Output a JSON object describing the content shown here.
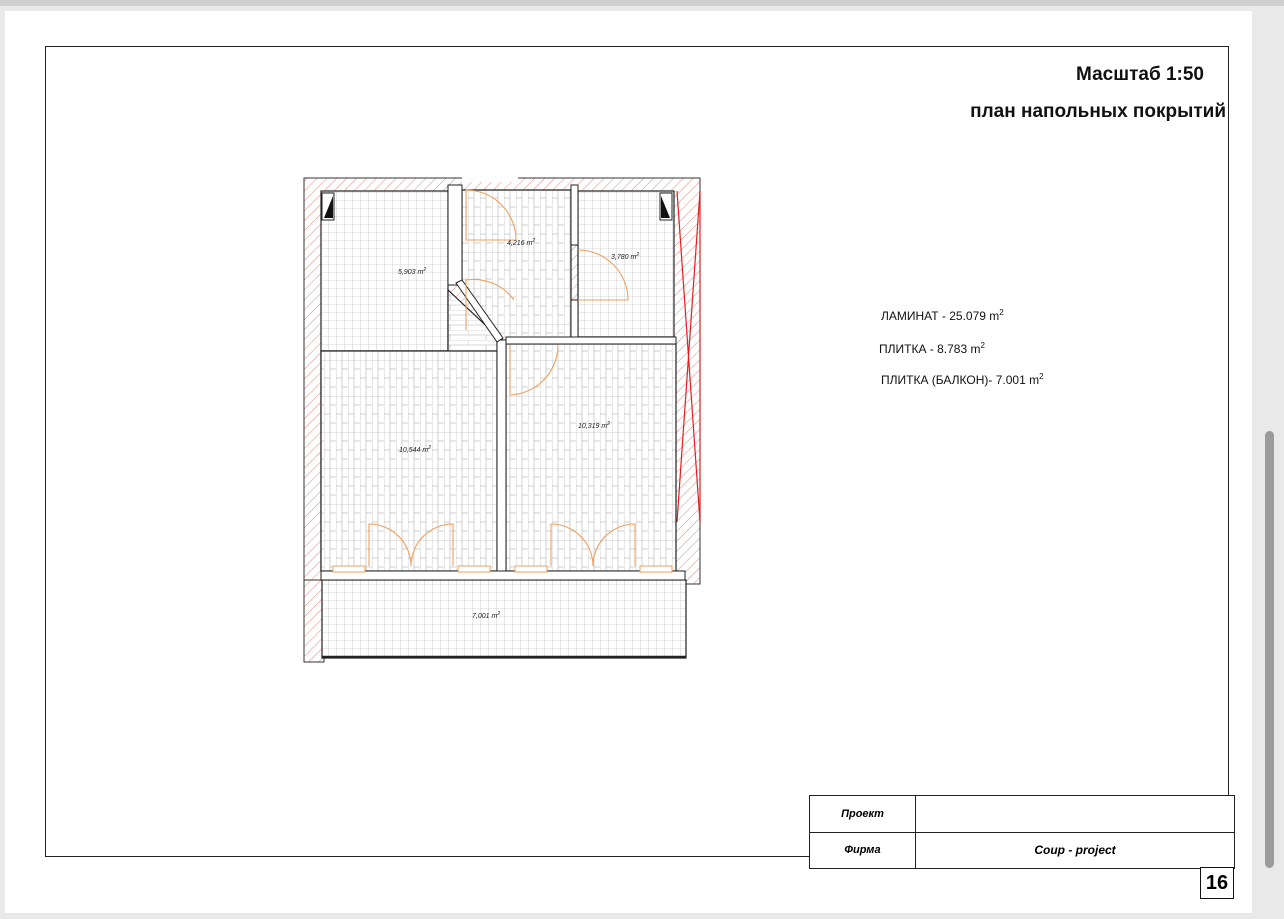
{
  "header": {
    "scale": "Масштаб 1:50",
    "title": "план напольных покрытий"
  },
  "legend": [
    {
      "material": "ЛАМИНАТ",
      "separator": " - ",
      "value": "25.079 m",
      "sup": "2"
    },
    {
      "material": "ПЛИТКА",
      "separator": " - ",
      "value": "8.783 m",
      "sup": "2"
    },
    {
      "material": "ПЛИТКА (БАЛКОН)-",
      "separator": " ",
      "value": "7.001 m",
      "sup": "2"
    }
  ],
  "rooms": [
    {
      "area": "5,903",
      "unit": "m",
      "sup": "2",
      "floor": "tile"
    },
    {
      "area": "4,216",
      "unit": "m",
      "sup": "2",
      "floor": "laminate"
    },
    {
      "area": "3,780",
      "unit": "m",
      "sup": "2",
      "floor": "tile"
    },
    {
      "area": "10,544",
      "unit": "m",
      "sup": "2",
      "floor": "laminate"
    },
    {
      "area": "10,319",
      "unit": "m",
      "sup": "2",
      "floor": "laminate"
    },
    {
      "area": "7,001",
      "unit": "m",
      "sup": "2",
      "floor": "tile"
    }
  ],
  "title_block": {
    "project_label": "Проект",
    "project_value": "",
    "firm_label": "Фирма",
    "firm_value": "Coup - project"
  },
  "page_number": "16",
  "colors": {
    "wall_hatch": "#e08a80",
    "door": "#f0a060",
    "grid": "#a9a9a9",
    "accent_red": "#e02020"
  },
  "icons": {
    "column": "black-triangle-icon"
  }
}
